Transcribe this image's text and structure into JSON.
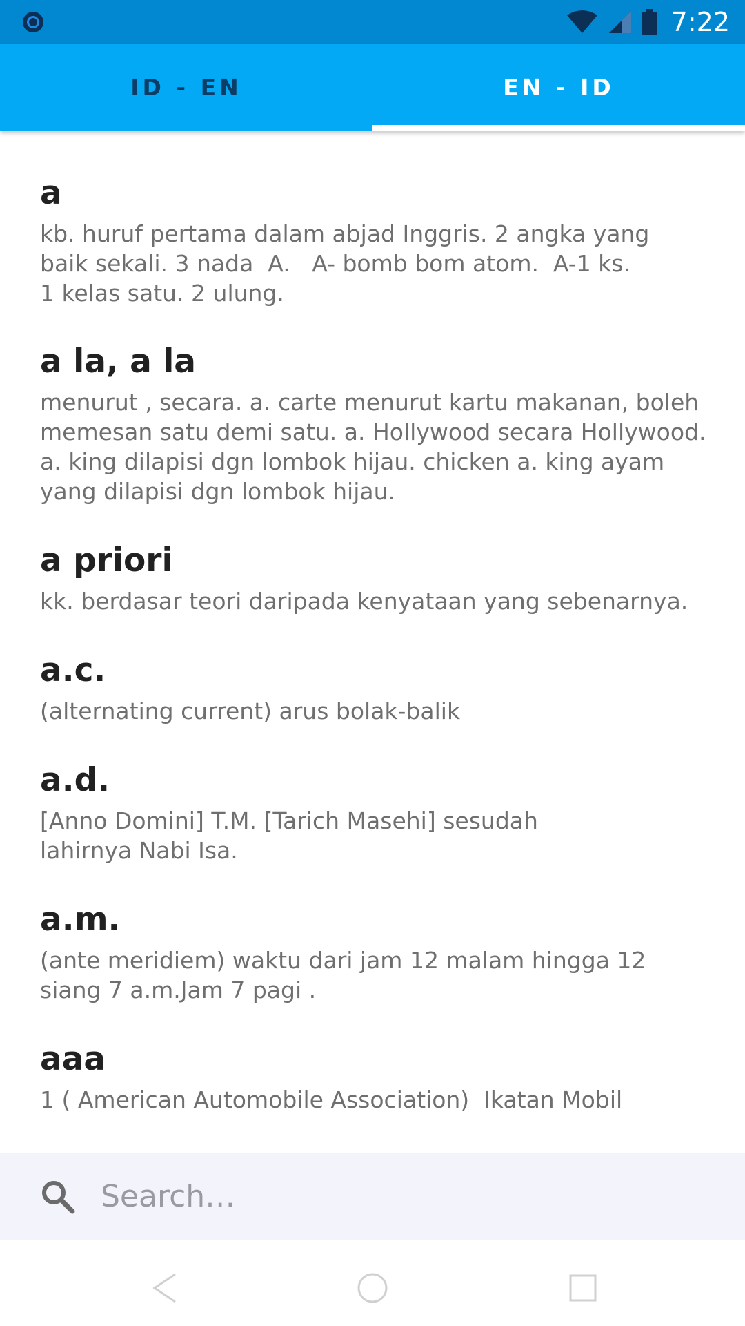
{
  "status_bar": {
    "time": "7:22",
    "icons": [
      "notification-circle-icon",
      "wifi-icon",
      "cell-signal-icon",
      "battery-icon"
    ]
  },
  "tabs": [
    {
      "label": "ID - EN",
      "active": false
    },
    {
      "label": "EN - ID",
      "active": true
    }
  ],
  "entries": [
    {
      "word": "a",
      "definition": "kb. huruf pertama dalam abjad Inggris. 2 angka yang\nbaik sekali. 3 nada  A.   A- bomb bom atom.  A-1 ks.\n1 kelas satu. 2 ulung."
    },
    {
      "word": "a la, a la",
      "definition": "menurut , secara. a. carte menurut kartu makanan, boleh\nmemesan satu demi satu. a. Hollywood secara Hollywood.\na. king dilapisi dgn lombok hijau. chicken a. king ayam\nyang dilapisi dgn lombok hijau."
    },
    {
      "word": "a priori",
      "definition": "kk. berdasar teori daripada kenyataan yang sebenarnya."
    },
    {
      "word": "a.c.",
      "definition": "(alternating current) arus bolak-balik"
    },
    {
      "word": "a.d.",
      "definition": "[Anno Domini] T.M. [Tarich Masehi] sesudah\nlahirnya Nabi Isa."
    },
    {
      "word": "a.m.",
      "definition": "(ante meridiem) waktu dari jam 12 malam hingga 12\nsiang 7 a.m.Jam 7 pagi ."
    },
    {
      "word": "aaa",
      "definition": "1 ( American Automobile Association)  Ikatan Mobil"
    }
  ],
  "search": {
    "placeholder": "Search…",
    "value": ""
  },
  "colors": {
    "status_bar": "#0288D1",
    "app_bar": "#03A9F4",
    "search_bg": "#F3F4FB"
  },
  "nav_icons": [
    "back-icon",
    "home-icon",
    "recents-icon"
  ]
}
